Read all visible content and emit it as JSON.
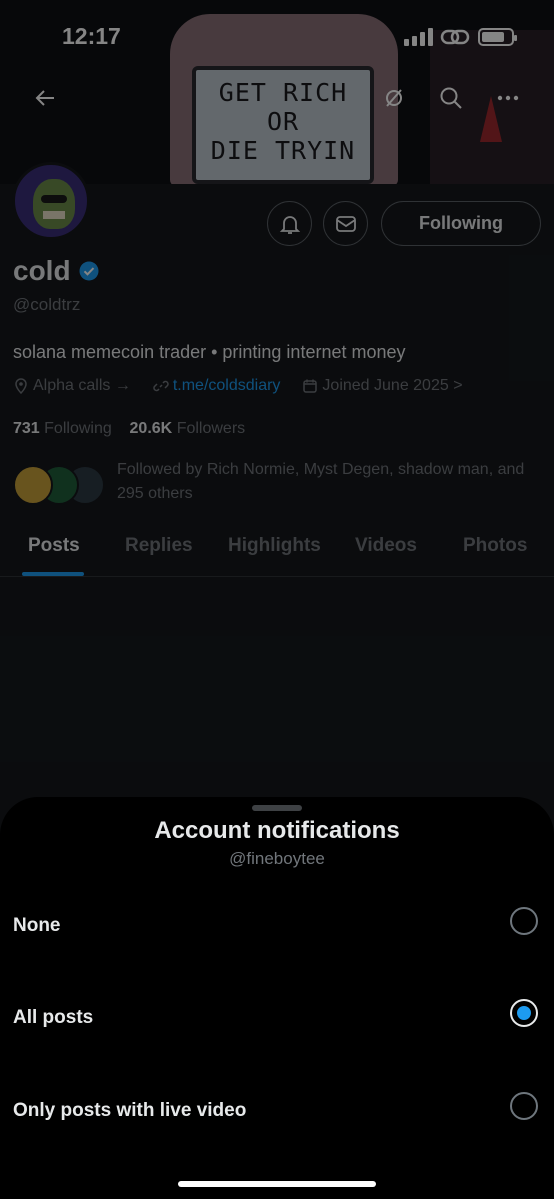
{
  "status_bar": {
    "time": "12:17"
  },
  "banner": {
    "marquee_lines": [
      "GET RICH",
      "OR",
      "DIE TRYIN"
    ]
  },
  "profile": {
    "display_name": "cold",
    "handle": "@coldtrz",
    "bio": "solana memecoin trader • printing internet money",
    "meta": {
      "category": "Alpha calls →",
      "link": "t.me/coldsdiary",
      "joined": "Joined June 2025 >"
    },
    "following_count": "731",
    "following_label": "Following",
    "followers_count": "20.6K",
    "followers_label": "Followers",
    "followed_by": "Followed by Rich Normie, Myst Degen, shadow man, and 295 others",
    "following_button": "Following"
  },
  "tabs": [
    "Posts",
    "Replies",
    "Highlights",
    "Videos",
    "Photos"
  ],
  "sheet": {
    "title": "Account notifications",
    "subtitle": "@fineboytee",
    "options": [
      {
        "label": "None",
        "selected": false
      },
      {
        "label": "All posts",
        "selected": true
      },
      {
        "label": "Only posts with live video",
        "selected": false
      }
    ]
  },
  "colors": {
    "accent": "#1d9bf0",
    "background": "#16181c",
    "sheet": "#000000"
  }
}
